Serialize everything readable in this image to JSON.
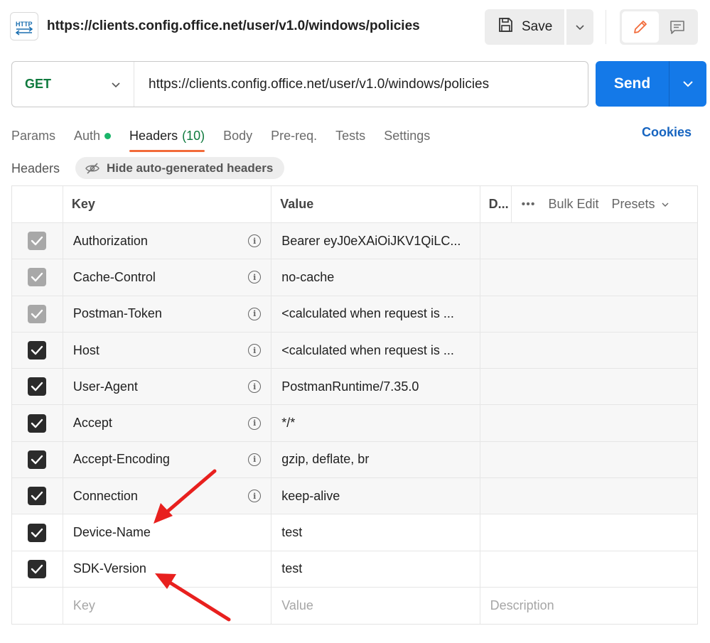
{
  "header": {
    "request_icon": "http-request-icon",
    "title": "https://clients.config.office.net/user/v1.0/windows/policies",
    "save_label": "Save"
  },
  "request": {
    "method": "GET",
    "url": "https://clients.config.office.net/user/v1.0/windows/policies",
    "send_label": "Send"
  },
  "tabs": [
    {
      "label": "Params"
    },
    {
      "label": "Auth"
    },
    {
      "label": "Headers",
      "count": "(10)"
    },
    {
      "label": "Body"
    },
    {
      "label": "Pre-req."
    },
    {
      "label": "Tests"
    },
    {
      "label": "Settings"
    }
  ],
  "cookies_label": "Cookies",
  "headers_section": {
    "label": "Headers",
    "hide_auto_label": "Hide auto-generated headers",
    "columns": {
      "key": "Key",
      "value": "Value",
      "description": "D...",
      "bulk_edit": "Bulk Edit",
      "presets": "Presets"
    },
    "rows": [
      {
        "key": "Authorization",
        "value": "Bearer eyJ0eXAiOiJKV1QiLC...",
        "checked": true,
        "auto": true
      },
      {
        "key": "Cache-Control",
        "value": "no-cache",
        "checked": true,
        "auto": true
      },
      {
        "key": "Postman-Token",
        "value": "<calculated when request is ...",
        "checked": true,
        "auto": true
      },
      {
        "key": "Host",
        "value": "<calculated when request is ...",
        "checked": true,
        "auto": true
      },
      {
        "key": "User-Agent",
        "value": "PostmanRuntime/7.35.0",
        "checked": true,
        "auto": true
      },
      {
        "key": "Accept",
        "value": "*/*",
        "checked": true,
        "auto": true
      },
      {
        "key": "Accept-Encoding",
        "value": "gzip, deflate, br",
        "checked": true,
        "auto": true
      },
      {
        "key": "Connection",
        "value": "keep-alive",
        "checked": true,
        "auto": true
      },
      {
        "key": "Device-Name",
        "value": "test",
        "checked": true,
        "auto": false
      },
      {
        "key": "SDK-Version",
        "value": "test",
        "checked": true,
        "auto": false
      }
    ],
    "new_row": {
      "key_placeholder": "Key",
      "value_placeholder": "Value",
      "description_placeholder": "Description"
    }
  },
  "colors": {
    "accent": "#1479e8",
    "method_green": "#0f7a3e",
    "active_tab": "#f26b3a",
    "annotation_arrow": "#e8201e"
  }
}
